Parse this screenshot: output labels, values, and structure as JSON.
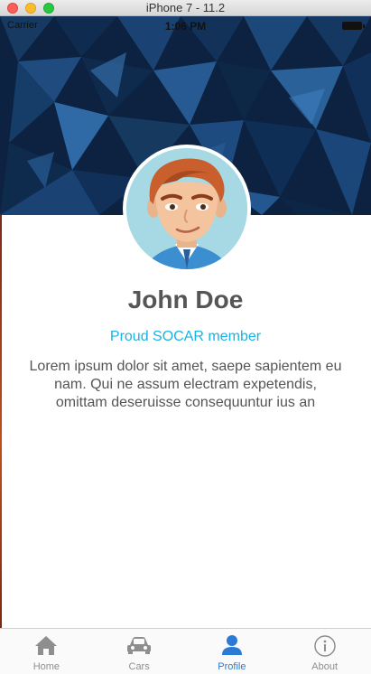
{
  "window": {
    "title": "iPhone 7 - 11.2"
  },
  "statusbar": {
    "carrier": "Carrier",
    "time": "1:06 PM"
  },
  "profile": {
    "name": "John Doe",
    "subtitle": "Proud SOCAR member",
    "bio": "Lorem ipsum dolor sit amet, saepe sapientem eu nam. Qui ne assum electram expetendis, omittam deseruisse consequuntur ius an"
  },
  "tabs": [
    {
      "label": "Home",
      "icon": "home-icon",
      "active": false
    },
    {
      "label": "Cars",
      "icon": "car-icon",
      "active": false
    },
    {
      "label": "Profile",
      "icon": "person-icon",
      "active": true
    },
    {
      "label": "About",
      "icon": "info-icon",
      "active": false
    }
  ],
  "colors": {
    "accent": "#2a7ad6",
    "subtitle": "#16b3e6",
    "inactive": "#8e8e8e"
  }
}
